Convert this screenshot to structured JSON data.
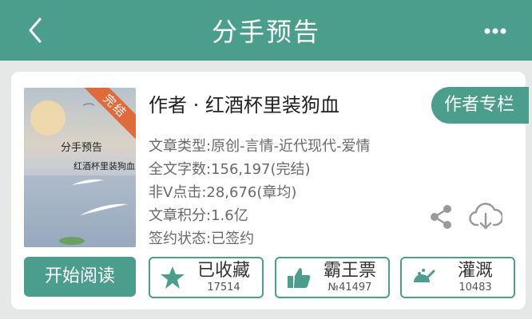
{
  "header": {
    "title": "分手预告"
  },
  "book": {
    "author_line": "作者 · 红酒杯里装狗血",
    "author_column_label": "作者专栏",
    "cover": {
      "title": "分手预告",
      "author": "红酒杯里装狗血",
      "status_ribbon": "完结"
    },
    "info": [
      "文章类型:原创-言情-近代现代-爱情",
      "全文字数:156,197(完结)",
      "非Ⅴ点击:28,676(章均)",
      "文章积分:1.6亿",
      "签约状态:已签约"
    ]
  },
  "actions": {
    "read_label": "开始阅读",
    "collect": {
      "label": "已收藏",
      "count": "17514"
    },
    "ticket": {
      "label": "霸王票",
      "count": "№41497"
    },
    "water": {
      "label": "灌溉",
      "count": "10483"
    }
  },
  "colors": {
    "primary": "#4a9e8b",
    "ribbon": "#e06a3b"
  }
}
